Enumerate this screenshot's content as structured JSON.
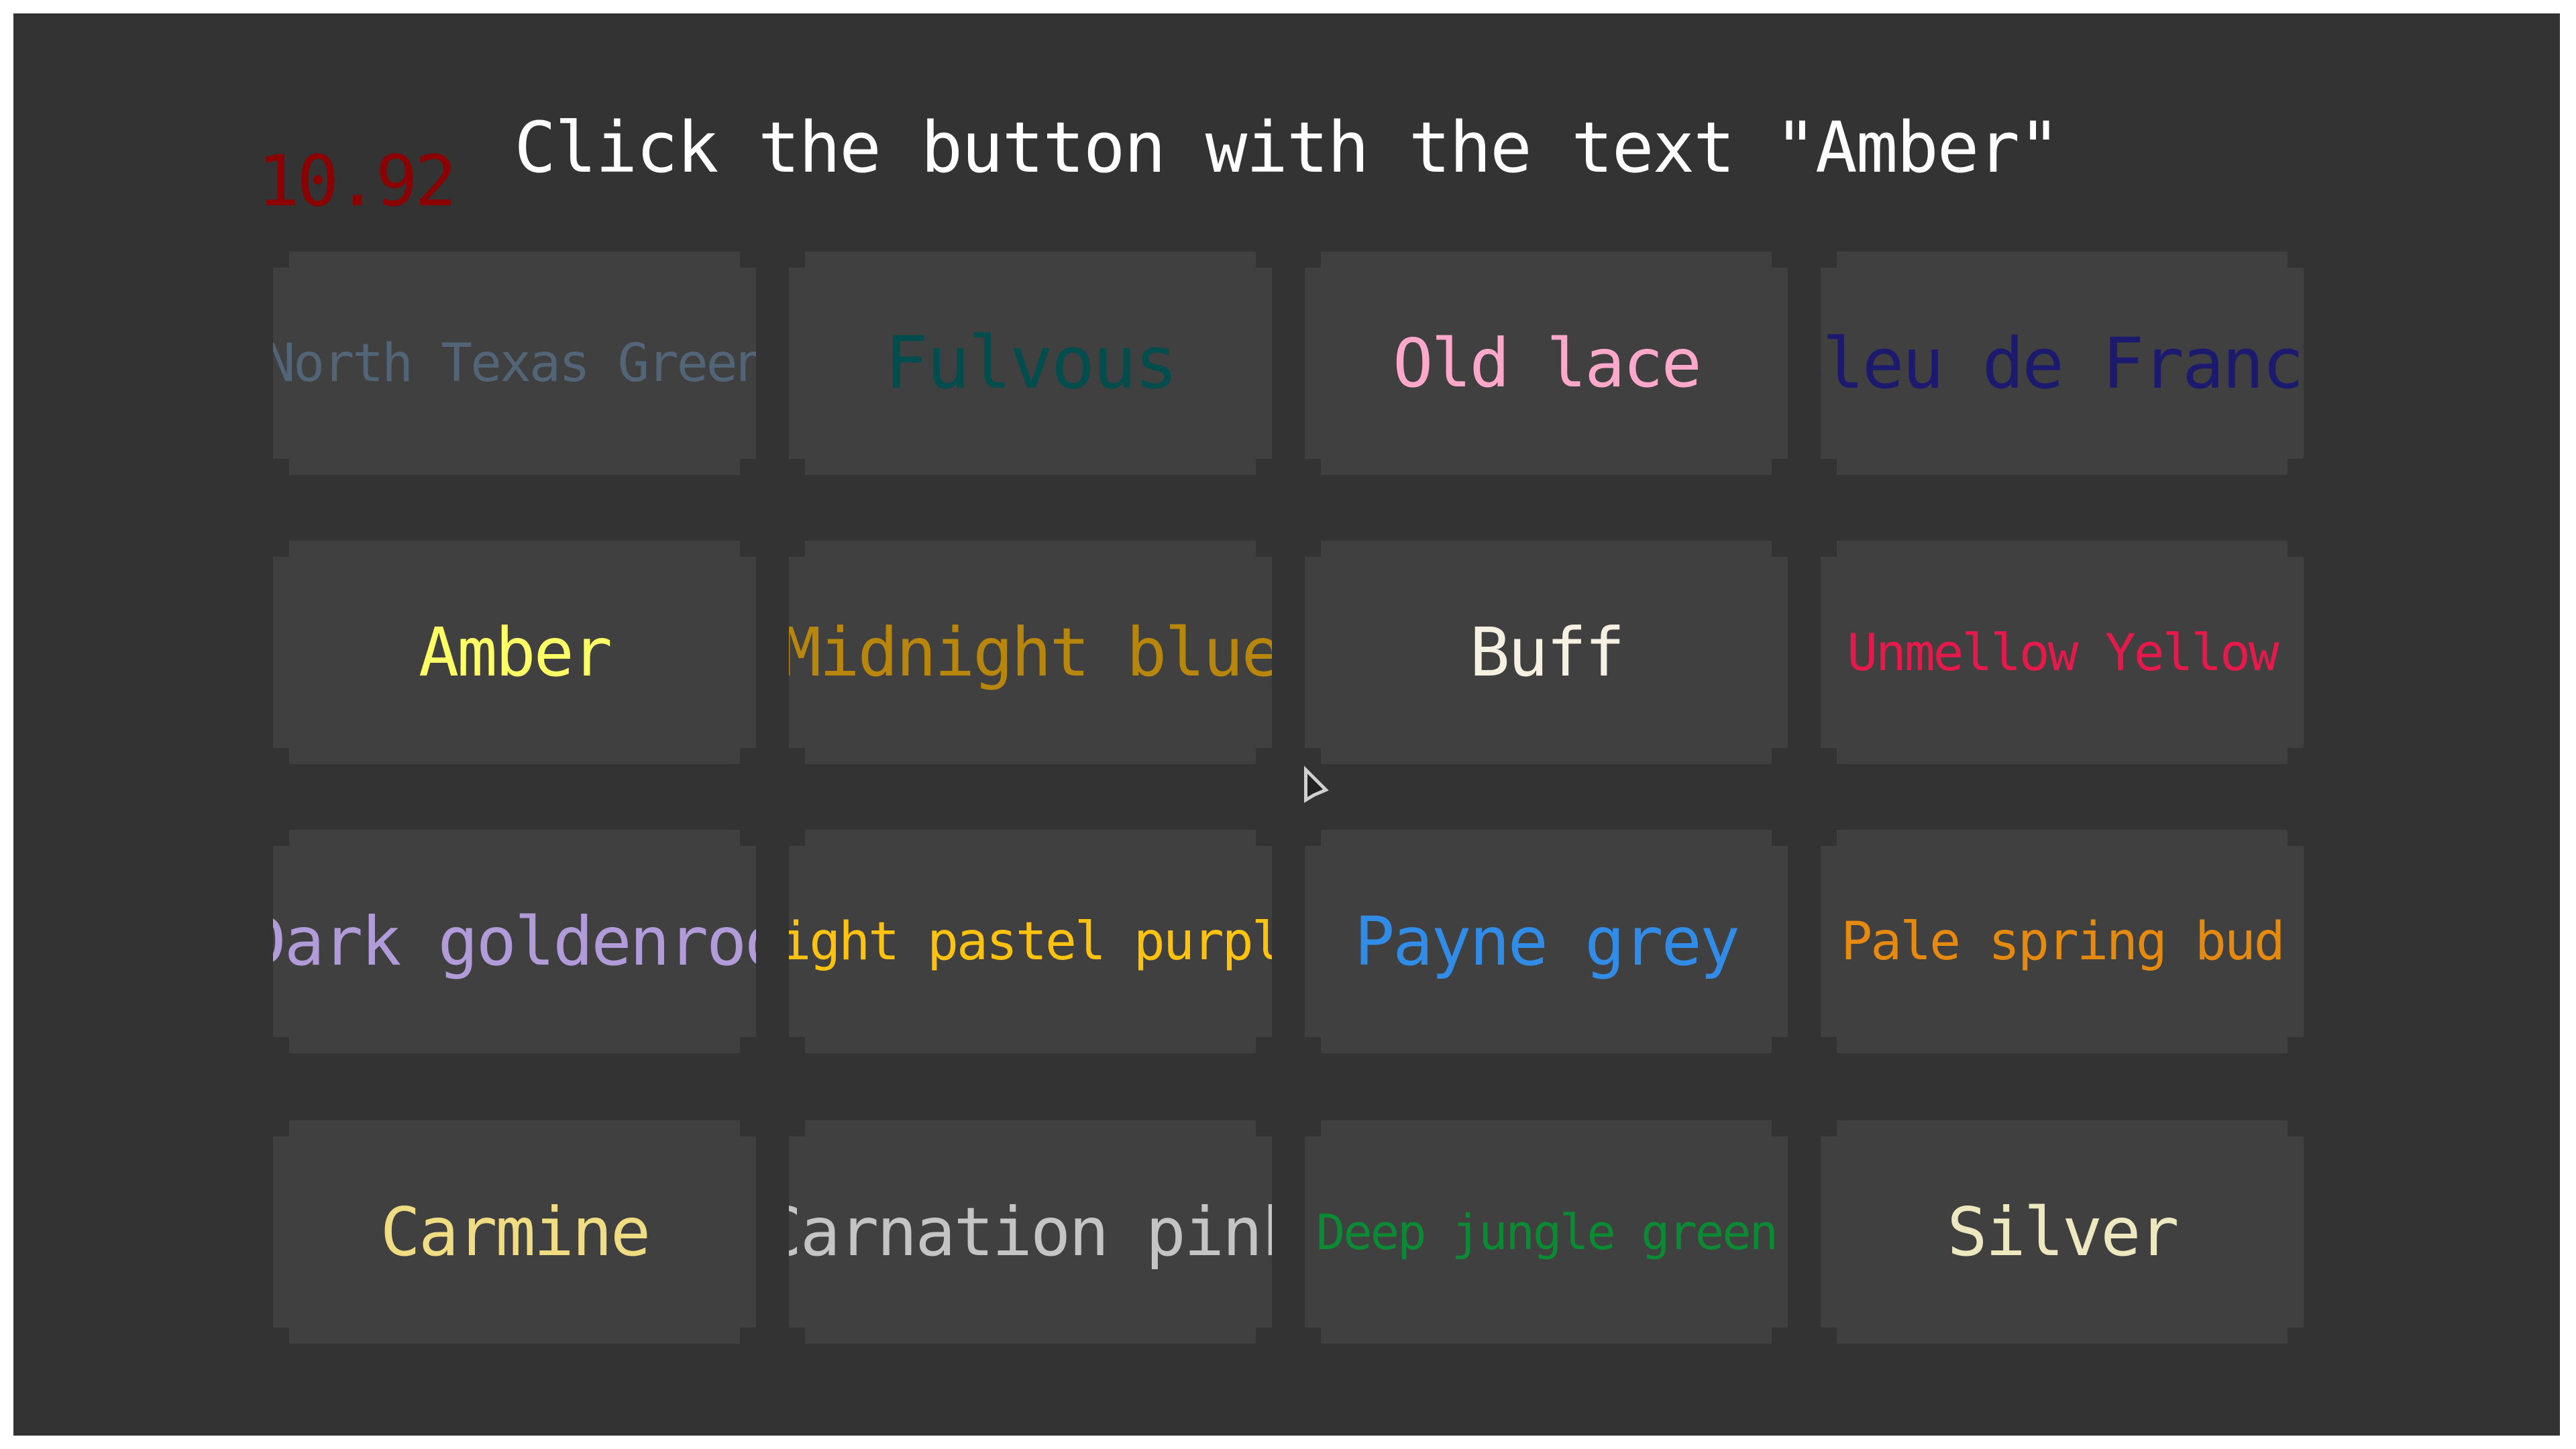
{
  "instruction": "Click the button with the text \"Amber\"",
  "timer": "10.92",
  "buttons": [
    {
      "label": "North Texas Green",
      "color": "#526577",
      "size": 78
    },
    {
      "label": "Fulvous",
      "color": "#004d4d",
      "size": 108
    },
    {
      "label": "Old lace",
      "color": "#ffa8cc",
      "size": 100
    },
    {
      "label": "Bleu de France",
      "color": "#1c1a6e",
      "size": 104
    },
    {
      "label": "Amber",
      "color": "#ffff66",
      "size": 100
    },
    {
      "label": "Midnight blue",
      "color": "#b8860b",
      "size": 100
    },
    {
      "label": "Buff",
      "color": "#f5f0e1",
      "size": 100
    },
    {
      "label": "Unmellow Yellow",
      "color": "#e6194b",
      "size": 76
    },
    {
      "label": "Dark goldenrod",
      "color": "#b19cd9",
      "size": 100
    },
    {
      "label": "Light pastel purple",
      "color": "#ffc20e",
      "size": 78
    },
    {
      "label": "Payne grey",
      "color": "#318ce7",
      "size": 100
    },
    {
      "label": "Pale spring bud",
      "color": "#e58a0f",
      "size": 78
    },
    {
      "label": "Carmine",
      "color": "#f0dc82",
      "size": 100
    },
    {
      "label": "Carnation pink",
      "color": "#c4c4c4",
      "size": 100
    },
    {
      "label": "Deep jungle green",
      "color": "#0a8a32",
      "size": 72
    },
    {
      "label": "Silver",
      "color": "#eee8c0",
      "size": 100
    }
  ]
}
